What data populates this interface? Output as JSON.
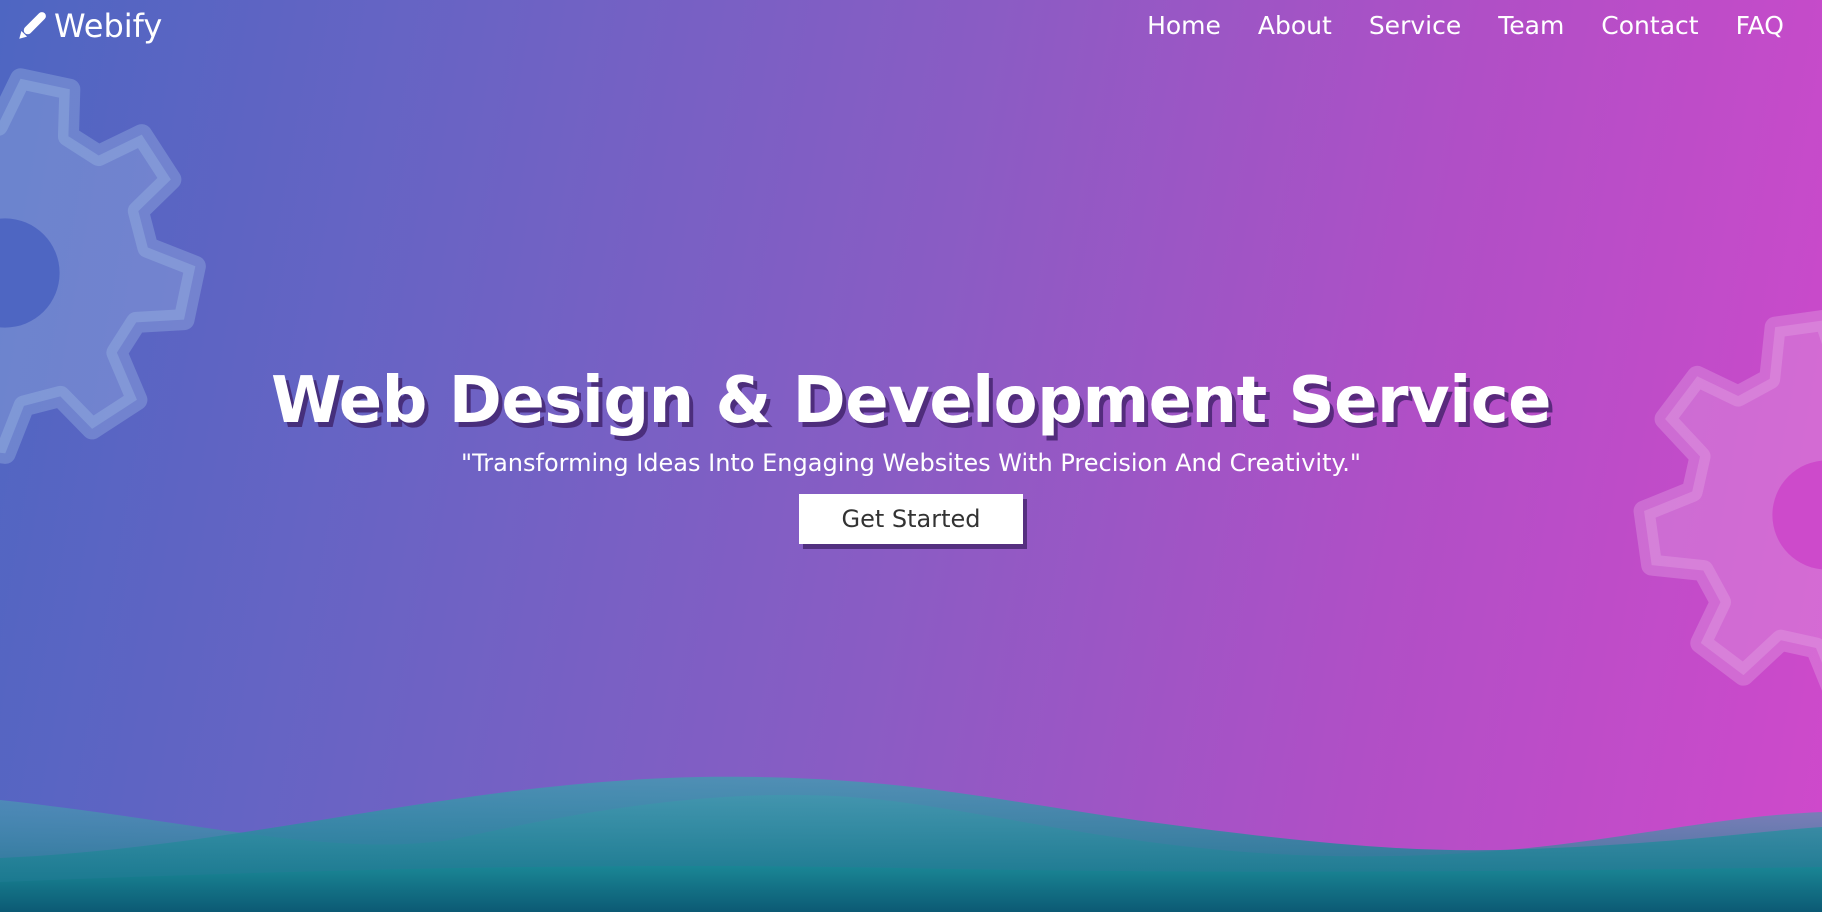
{
  "brand": {
    "name": "Webify",
    "icon": "pencil-icon"
  },
  "nav": {
    "items": [
      {
        "label": "Home"
      },
      {
        "label": "About"
      },
      {
        "label": "Service"
      },
      {
        "label": "Team"
      },
      {
        "label": "Contact"
      },
      {
        "label": "FAQ"
      }
    ]
  },
  "hero": {
    "title": "Web Design & Development Service",
    "tagline": "\"Transforming Ideas Into Engaging Websites With Precision And Creativity.\"",
    "cta_label": "Get Started"
  },
  "decorations": {
    "left_icon": "gear-icon",
    "right_icon": "gear-icon"
  },
  "colors": {
    "gradient_start": "#4e66c2",
    "gradient_end": "#cf49cb",
    "wave_teal": "#1b8d9a",
    "text": "#ffffff",
    "button_text": "#333333"
  }
}
